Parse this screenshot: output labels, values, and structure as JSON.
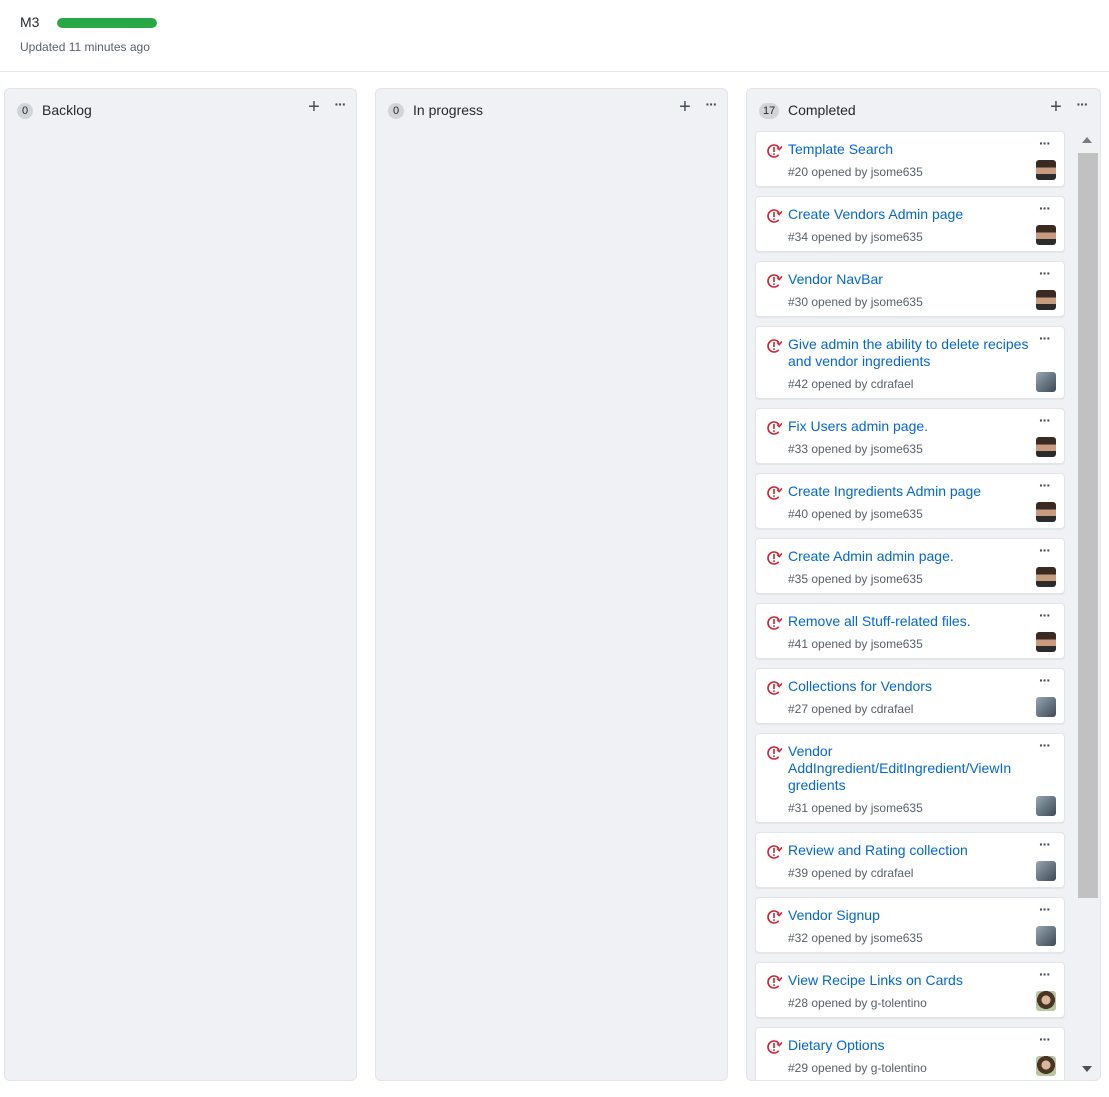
{
  "header": {
    "title": "M3",
    "progress_percent": 100,
    "progress_color": "#28a745",
    "updated": "Updated 11 minutes ago"
  },
  "columns": [
    {
      "count": "0",
      "name": "Backlog",
      "add_icon": "plus-icon",
      "more_icon": "kebab-horizontal-icon"
    },
    {
      "count": "0",
      "name": "In progress",
      "add_icon": "plus-icon",
      "more_icon": "kebab-horizontal-icon"
    },
    {
      "count": "17",
      "name": "Completed",
      "add_icon": "plus-icon",
      "more_icon": "kebab-horizontal-icon"
    }
  ],
  "cards": [
    {
      "title": "Template Search",
      "meta": "#20 opened by jsome635",
      "avatar": "a1"
    },
    {
      "title": "Create Vendors Admin page",
      "meta": "#34 opened by jsome635",
      "avatar": "a1"
    },
    {
      "title": "Vendor NavBar",
      "meta": "#30 opened by jsome635",
      "avatar": "a1"
    },
    {
      "title": "Give admin the ability to delete recipes and vendor ingredients",
      "meta": "#42 opened by cdrafael",
      "avatar": "a2"
    },
    {
      "title": "Fix Users admin page.",
      "meta": "#33 opened by jsome635",
      "avatar": "a1"
    },
    {
      "title": "Create Ingredients Admin page",
      "meta": "#40 opened by jsome635",
      "avatar": "a1"
    },
    {
      "title": "Create Admin admin page.",
      "meta": "#35 opened by jsome635",
      "avatar": "a1"
    },
    {
      "title": "Remove all Stuff-related files.",
      "meta": "#41 opened by jsome635",
      "avatar": "a1"
    },
    {
      "title": "Collections for Vendors",
      "meta": "#27 opened by cdrafael",
      "avatar": "a2"
    },
    {
      "title": "Vendor AddIngredient/EditIngredient/ViewIn gredients",
      "meta": "#31 opened by jsome635",
      "avatar": "a2"
    },
    {
      "title": "Review and Rating collection",
      "meta": "#39 opened by cdrafael",
      "avatar": "a2"
    },
    {
      "title": "Vendor Signup",
      "meta": "#32 opened by jsome635",
      "avatar": "a2"
    },
    {
      "title": "View Recipe Links on Cards",
      "meta": "#28 opened by g-tolentino",
      "avatar": "a3"
    },
    {
      "title": "Dietary Options",
      "meta": "#29 opened by g-tolentino",
      "avatar": "a3"
    }
  ],
  "icons": {
    "issue": "issue-closed-icon",
    "issue_color": "#cb2431",
    "card_more": "kebab-horizontal-icon"
  }
}
